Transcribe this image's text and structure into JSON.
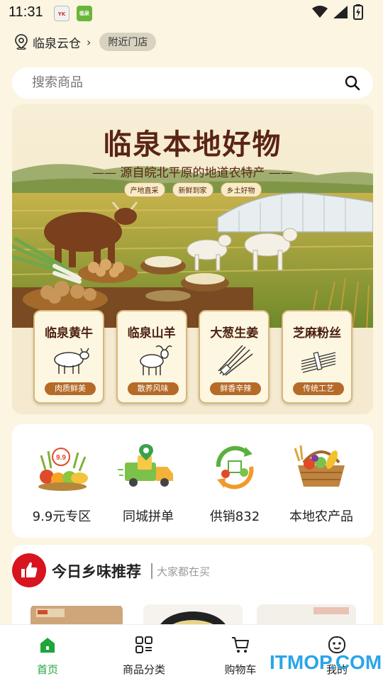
{
  "status_bar": {
    "time": "11:31",
    "app_icon_1": "YK",
    "app_icon_2": "临泉"
  },
  "location": {
    "name": "临泉云仓",
    "nearby_button": "附近门店"
  },
  "search": {
    "placeholder": "搜索商品"
  },
  "banner": {
    "title": "临泉本地好物",
    "subtitle": "—— 源自皖北平原的地道农特产 ——",
    "tags": [
      "产地直采",
      "新鲜到家",
      "乡土好物"
    ],
    "products": [
      {
        "title": "临泉黄牛",
        "badge": "肉质鲜美",
        "icon": "cow-icon"
      },
      {
        "title": "临泉山羊",
        "badge": "散养风味",
        "icon": "goat-icon"
      },
      {
        "title": "大葱生姜",
        "badge": "鲜香辛辣",
        "icon": "scallion-icon"
      },
      {
        "title": "芝麻粉丝",
        "badge": "传统工艺",
        "icon": "vermicelli-icon"
      }
    ]
  },
  "categories": [
    {
      "label": "9.9元专区",
      "icon": "fruit-basket-icon",
      "icon_text": "9.9"
    },
    {
      "label": "同城拼单",
      "icon": "delivery-truck-icon"
    },
    {
      "label": "供销832",
      "icon": "recycle-veggie-icon"
    },
    {
      "label": "本地农产品",
      "icon": "produce-basket-icon"
    }
  ],
  "recommend": {
    "title": "今日乡味推荐",
    "subtitle": "大家都在买"
  },
  "bottom_nav": [
    {
      "label": "首页",
      "icon": "home-icon",
      "active": true
    },
    {
      "label": "商品分类",
      "icon": "category-icon",
      "active": false
    },
    {
      "label": "购物车",
      "icon": "cart-icon",
      "active": false
    },
    {
      "label": "我的",
      "icon": "profile-icon",
      "active": false
    }
  ],
  "watermark": "ITMOP.COM",
  "colors": {
    "background": "#fbf5e2",
    "accent_green": "#1fa53a",
    "badge_red": "#d8141f",
    "banner_brown": "#5a2415",
    "watermark_blue": "#2aa5e8"
  }
}
